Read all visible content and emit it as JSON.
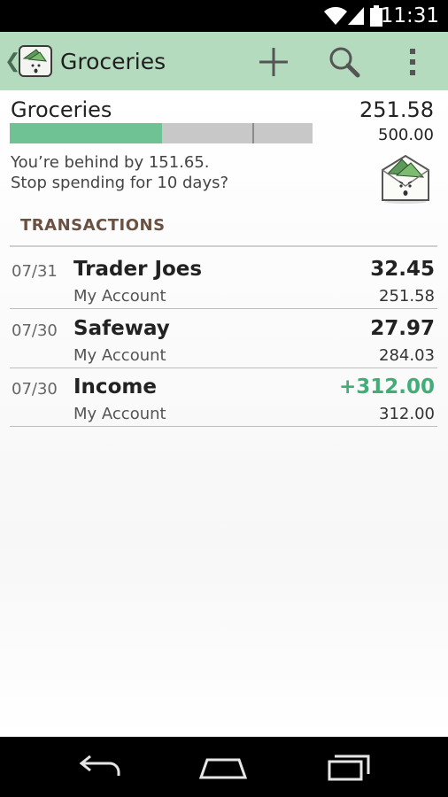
{
  "status_bar": {
    "time": "11:31",
    "icons": [
      "wifi-icon",
      "signal-icon",
      "battery-icon"
    ]
  },
  "action_bar": {
    "title": "Groceries",
    "actions": [
      {
        "name": "add-icon"
      },
      {
        "name": "search-icon"
      },
      {
        "name": "overflow-menu-icon"
      }
    ]
  },
  "budget": {
    "name": "Groceries",
    "spent": "251.58",
    "total": "500.00",
    "progress_fraction": 0.503,
    "time_marker_fraction": 0.8,
    "message_line1": "You’re behind by 151.65.",
    "message_line2": "Stop spending for 10 days?"
  },
  "section": {
    "title": "TRANSACTIONS"
  },
  "transactions": [
    {
      "date": "07/31",
      "payee": "Trader Joes",
      "account": "My Account",
      "amount": "32.45",
      "balance": "251.58",
      "type": "expense"
    },
    {
      "date": "07/30",
      "payee": "Safeway",
      "account": "My Account",
      "amount": "27.97",
      "balance": "284.03",
      "type": "expense"
    },
    {
      "date": "07/30",
      "payee": "Income",
      "account": "My Account",
      "amount": "+312.00",
      "balance": "312.00",
      "type": "income"
    }
  ],
  "colors": {
    "action_bar": "#b4dbbe",
    "progress_fill": "#6fc294",
    "progress_track": "#c8c8c8",
    "income": "#3fae77",
    "section_header": "#6b5142"
  },
  "nav_bar": {
    "buttons": [
      "back-icon",
      "home-icon",
      "recents-icon"
    ]
  }
}
